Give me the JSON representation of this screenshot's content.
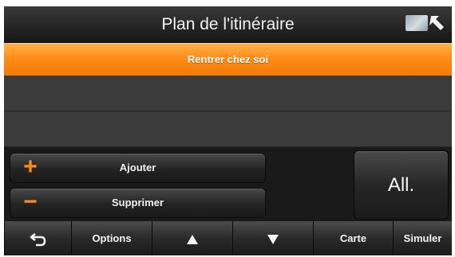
{
  "header": {
    "title": "Plan de l'itinéraire",
    "map_button_icon": "map-back-icon"
  },
  "route": {
    "items": [
      "Rentrer chez soi"
    ]
  },
  "actions": {
    "add_label": "Ajouter",
    "add_icon": "plus-icon",
    "remove_label": "Supprimer",
    "remove_icon": "minus-icon",
    "all_label": "All."
  },
  "toolbar": {
    "back_icon": "back-arrow-icon",
    "options_label": "Options",
    "up_icon": "up-triangle-icon",
    "down_icon": "down-triangle-icon",
    "map_label": "Carte",
    "simulate_label": "Simuler"
  },
  "colors": {
    "accent": "#ff8c14",
    "selected_row": "#ff8c1a",
    "background": "#1a1a1a"
  }
}
